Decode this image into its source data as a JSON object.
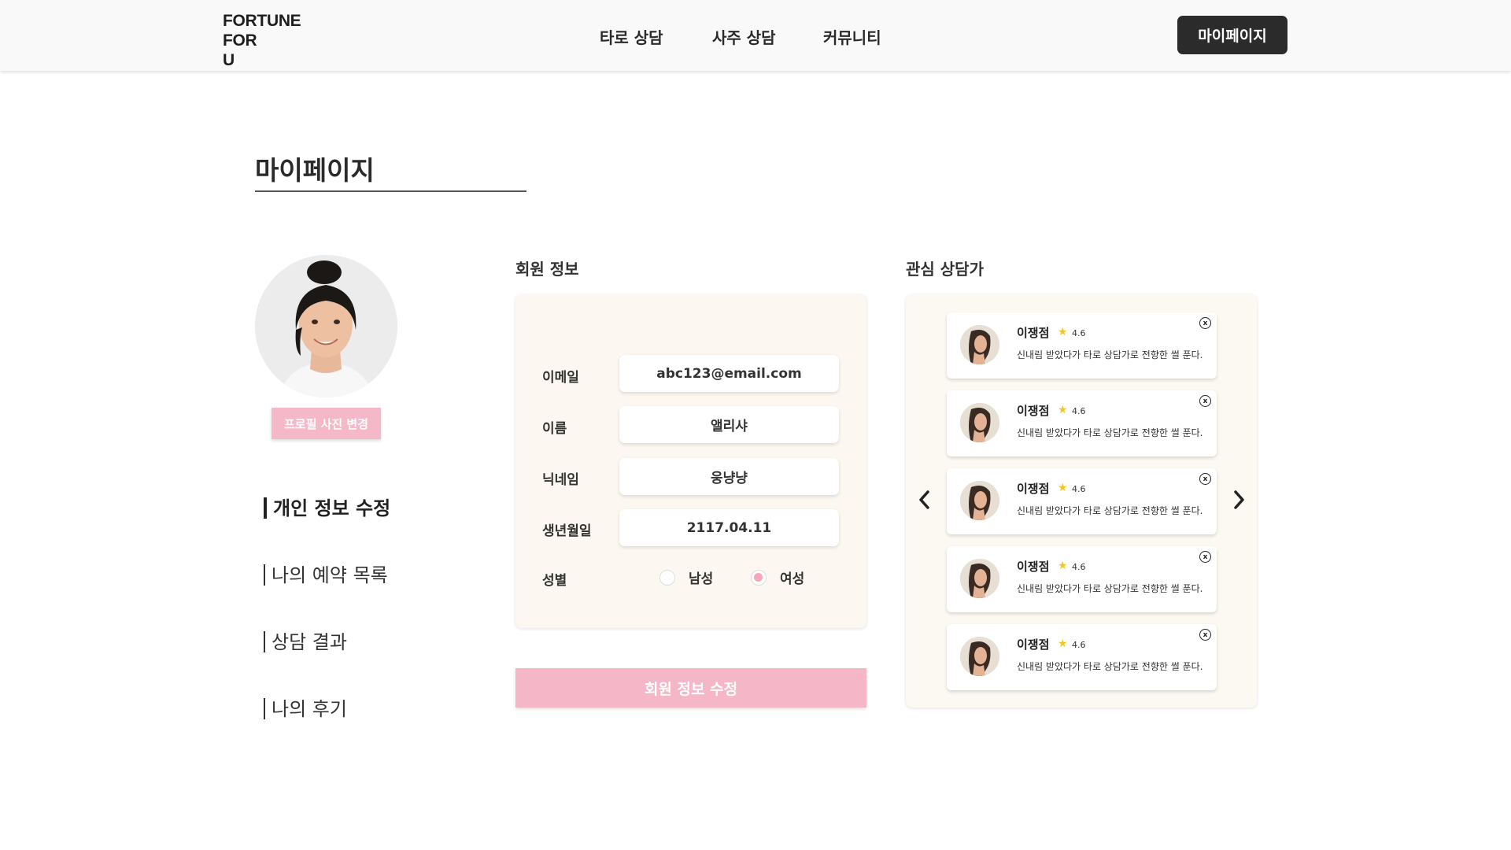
{
  "header": {
    "logo_lines": [
      "FORTUNE",
      "FOR",
      "U"
    ],
    "nav": [
      "타로 상담",
      "사주 상담",
      "커뮤니티"
    ],
    "mypage_button": "마이페이지"
  },
  "page": {
    "title": "마이페이지"
  },
  "profile": {
    "change_photo_button": "프로필 사진 변경"
  },
  "sidebar": {
    "items": [
      {
        "label": "개인 정보 수정",
        "active": true
      },
      {
        "label": "나의 예약 목록",
        "active": false
      },
      {
        "label": "상담 결과",
        "active": false
      },
      {
        "label": "나의 후기",
        "active": false
      }
    ]
  },
  "member_info": {
    "title": "회원 정보",
    "fields": [
      {
        "label": "이메일",
        "value": "abc123@email.com"
      },
      {
        "label": "이름",
        "value": "앨리샤"
      },
      {
        "label": "닉네임",
        "value": "웅냥냥"
      },
      {
        "label": "생년월일",
        "value": "2117.04.11"
      }
    ],
    "gender": {
      "label": "성별",
      "options": [
        "남성",
        "여성"
      ],
      "selected": "여성"
    },
    "submit_button": "회원 정보 수정"
  },
  "favorites": {
    "title": "관심 상담가",
    "counselors": [
      {
        "name": "이쟁점",
        "rating": "4.6",
        "description": "신내림 받았다가 타로 상담가로 전향한 썰 푼다."
      },
      {
        "name": "이쟁점",
        "rating": "4.6",
        "description": "신내림 받았다가 타로 상담가로 전향한 썰 푼다."
      },
      {
        "name": "이쟁점",
        "rating": "4.6",
        "description": "신내림 받았다가 타로 상담가로 전향한 썰 푼다."
      },
      {
        "name": "이쟁점",
        "rating": "4.6",
        "description": "신내림 받았다가 타로 상담가로 전향한 썰 푼다."
      },
      {
        "name": "이쟁점",
        "rating": "4.6",
        "description": "신내림 받았다가 타로 상담가로 전향한 썰 푼다."
      }
    ],
    "close_glyph": "x"
  },
  "colors": {
    "accent_pink": "#f5b7c8",
    "dark_button": "#2b2b2b",
    "card_background": "#fcf7f0",
    "star": "#f3c623"
  },
  "icons": [
    "chevron-left-icon",
    "chevron-right-icon",
    "star-icon",
    "close-icon"
  ]
}
